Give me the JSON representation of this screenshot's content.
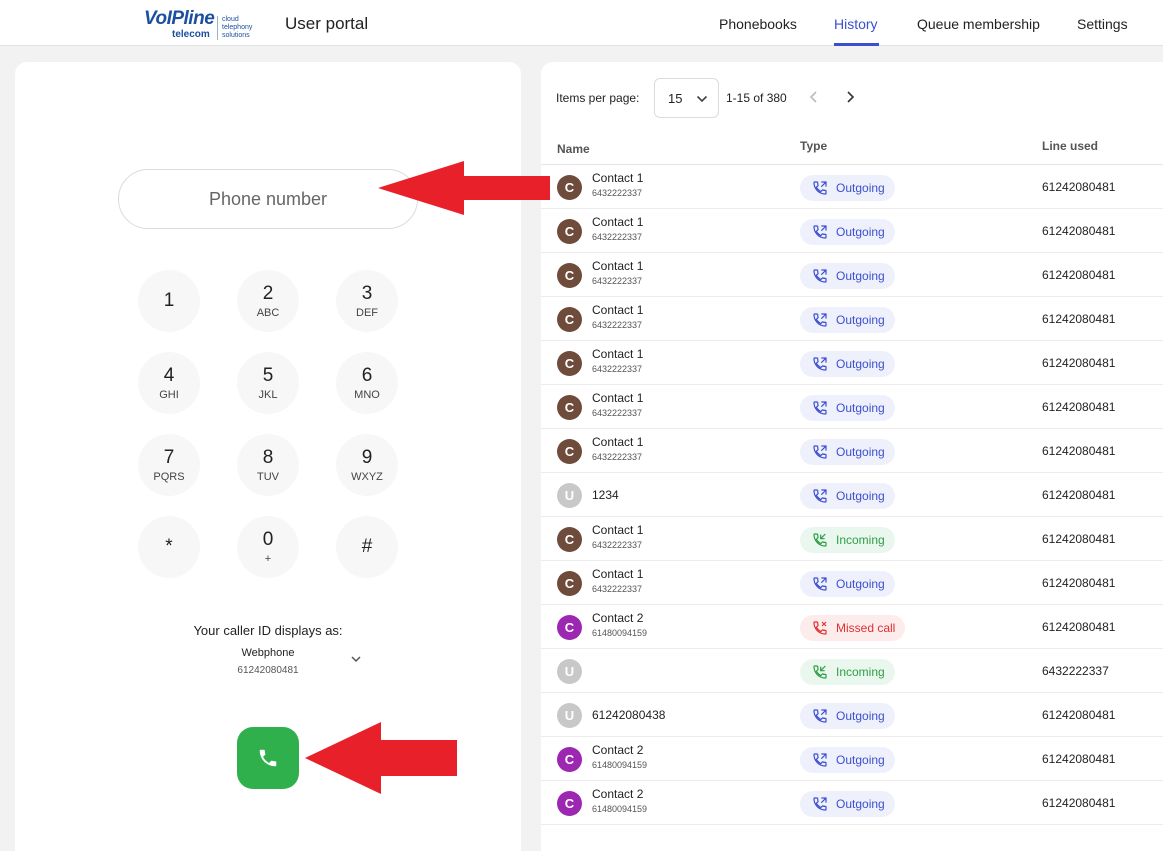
{
  "header": {
    "logo_brand": "VoIPline",
    "logo_sub": "telecom",
    "logo_tagline": "cloud\ntelephony\nsolutions",
    "title": "User portal",
    "nav": [
      "Phonebooks",
      "History",
      "Queue membership",
      "Settings"
    ],
    "active_nav": "History"
  },
  "dialer": {
    "placeholder": "Phone number",
    "keys": [
      {
        "digit": "1",
        "letters": ""
      },
      {
        "digit": "2",
        "letters": "ABC"
      },
      {
        "digit": "3",
        "letters": "DEF"
      },
      {
        "digit": "4",
        "letters": "GHI"
      },
      {
        "digit": "5",
        "letters": "JKL"
      },
      {
        "digit": "6",
        "letters": "MNO"
      },
      {
        "digit": "7",
        "letters": "PQRS"
      },
      {
        "digit": "8",
        "letters": "TUV"
      },
      {
        "digit": "9",
        "letters": "WXYZ"
      },
      {
        "digit": "*",
        "letters": ""
      },
      {
        "digit": "0",
        "letters": "+"
      },
      {
        "digit": "#",
        "letters": ""
      }
    ],
    "caller_id_label": "Your caller ID displays as:",
    "caller_id_name": "Webphone",
    "caller_id_number": "61242080481",
    "call_icon": "phone-icon"
  },
  "history": {
    "items_per_page_label": "Items per page:",
    "items_per_page": "15",
    "range": "1-15 of 380",
    "columns": [
      "Name",
      "Type",
      "Line used"
    ],
    "rows": [
      {
        "initial": "C",
        "name": "Contact 1",
        "number": "6432222337",
        "type": "Outgoing",
        "line": "61242080481"
      },
      {
        "initial": "C",
        "name": "Contact 1",
        "number": "6432222337",
        "type": "Outgoing",
        "line": "61242080481"
      },
      {
        "initial": "C",
        "name": "Contact 1",
        "number": "6432222337",
        "type": "Outgoing",
        "line": "61242080481"
      },
      {
        "initial": "C",
        "name": "Contact 1",
        "number": "6432222337",
        "type": "Outgoing",
        "line": "61242080481"
      },
      {
        "initial": "C",
        "name": "Contact 1",
        "number": "6432222337",
        "type": "Outgoing",
        "line": "61242080481"
      },
      {
        "initial": "C",
        "name": "Contact 1",
        "number": "6432222337",
        "type": "Outgoing",
        "line": "61242080481"
      },
      {
        "initial": "C",
        "name": "Contact 1",
        "number": "6432222337",
        "type": "Outgoing",
        "line": "61242080481"
      },
      {
        "initial": "U",
        "name": "1234",
        "number": "",
        "type": "Outgoing",
        "line": "61242080481"
      },
      {
        "initial": "C",
        "name": "Contact 1",
        "number": "6432222337",
        "type": "Incoming",
        "line": "61242080481"
      },
      {
        "initial": "C",
        "name": "Contact 1",
        "number": "6432222337",
        "type": "Outgoing",
        "line": "61242080481"
      },
      {
        "initial": "C",
        "name": "Contact 2",
        "number": "61480094159",
        "type": "Missed call",
        "line": "61242080481"
      },
      {
        "initial": "U",
        "name": "",
        "number": "",
        "type": "Incoming",
        "line": "6432222337"
      },
      {
        "initial": "U",
        "name": "61242080438",
        "number": "",
        "type": "Outgoing",
        "line": "61242080481"
      },
      {
        "initial": "C",
        "name": "Contact 2",
        "number": "61480094159",
        "type": "Outgoing",
        "line": "61242080481"
      },
      {
        "initial": "C",
        "name": "Contact 2",
        "number": "61480094159",
        "type": "Outgoing",
        "line": "61242080481"
      }
    ]
  },
  "colors": {
    "accent": "#3b4fd0",
    "call_button": "#2fb04c",
    "avatar_contact1": "#6e4b3a",
    "avatar_contact2": "#9c27b0",
    "avatar_unknown": "#c8c8c8",
    "outgoing_text": "#3b4fd0",
    "outgoing_bg": "#eef0fb",
    "incoming_text": "#2e9e45",
    "incoming_bg": "#eaf7ee",
    "missed_text": "#e03131",
    "missed_bg": "#fdecec",
    "annotation_arrow": "#e8202a"
  }
}
